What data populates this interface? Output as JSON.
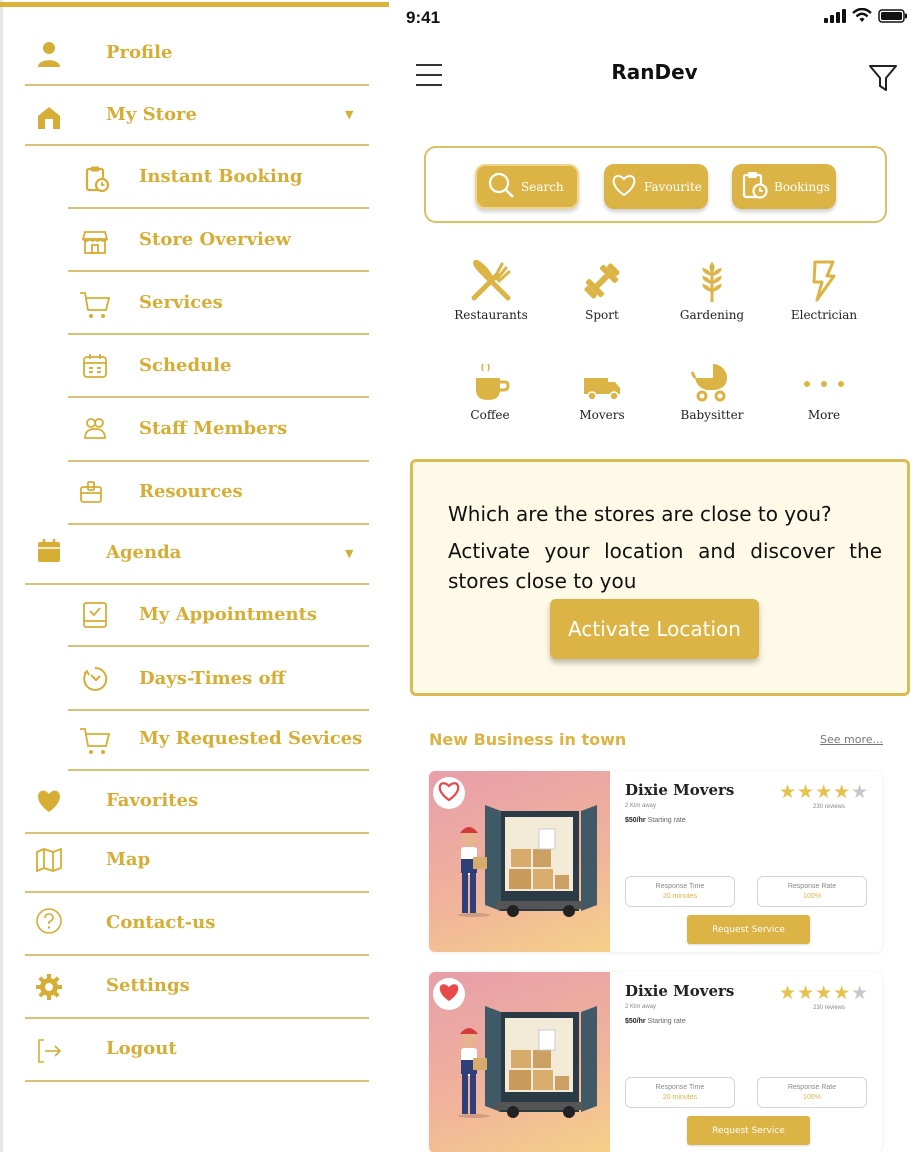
{
  "colors": {
    "accent": "#dcb446",
    "divider": "#dcc07a",
    "card_bg": "#fff9e7",
    "heart_red": "#e84a4a"
  },
  "drawer": {
    "items": [
      {
        "label": "Profile",
        "icon": "person-icon"
      },
      {
        "label": "My Store",
        "icon": "store-icon",
        "caret": "▼"
      },
      {
        "label": "Instant Booking",
        "icon": "clipboard-clock-icon"
      },
      {
        "label": "Store Overview",
        "icon": "storefront-icon"
      },
      {
        "label": "Services",
        "icon": "cart-icon"
      },
      {
        "label": "Schedule",
        "icon": "calendar-icon"
      },
      {
        "label": "Staff Members",
        "icon": "people-icon"
      },
      {
        "label": "Resources",
        "icon": "box-icon"
      },
      {
        "label": "Agenda",
        "icon": "calendar-filled-icon",
        "caret": "▼"
      },
      {
        "label": "My Appointments",
        "icon": "check-square-icon"
      },
      {
        "label": "Days-Times off",
        "icon": "timer-icon"
      },
      {
        "label": "My Requested Sevices",
        "icon": "cart-icon"
      },
      {
        "label": "Favorites",
        "icon": "heart-icon"
      },
      {
        "label": "Map",
        "icon": "map-icon"
      },
      {
        "label": "Contact-us",
        "icon": "question-icon"
      },
      {
        "label": "Settings",
        "icon": "gear-icon"
      },
      {
        "label": "Logout",
        "icon": "logout-icon"
      }
    ]
  },
  "status_bar": {
    "time": "9:41"
  },
  "header": {
    "title": "RanDev"
  },
  "actions": {
    "search": "Search",
    "favourite": "Favourite",
    "bookings": "Bookings"
  },
  "categories": [
    {
      "label": "Restaurants",
      "icon": "fork-knife-icon"
    },
    {
      "label": "Sport",
      "icon": "dumbbell-icon"
    },
    {
      "label": "Gardening",
      "icon": "wheat-icon"
    },
    {
      "label": "Electrician",
      "icon": "bolt-icon"
    },
    {
      "label": "Coffee",
      "icon": "coffee-icon"
    },
    {
      "label": "Movers",
      "icon": "truck-icon"
    },
    {
      "label": "Babysitter",
      "icon": "stroller-icon"
    },
    {
      "label": "More",
      "icon": "more-dots-icon"
    }
  ],
  "location_card": {
    "question": "Which are the stores are close to you?",
    "text": "Activate your location and discover the stores close to you",
    "button": "Activate Location"
  },
  "new_business": {
    "title": "New Business in town",
    "see_more": "See more..."
  },
  "businesses": [
    {
      "name": "Dixie Movers",
      "distance": "2 Klm away",
      "rate": "$50/hr",
      "rate_label": "Starting rate",
      "reviews": "230 reviews",
      "response_time_label": "Response Time",
      "response_time": "20 minutes",
      "response_rate_label": "Response Rate",
      "response_rate": "100%",
      "button": "Request Service",
      "rating": 4.5,
      "favorited": false
    },
    {
      "name": "Dixie Movers",
      "distance": "2 Klm away",
      "rate": "$50/hr",
      "rate_label": "Starting rate",
      "reviews": "230 reviews",
      "response_time_label": "Response Time",
      "response_time": "20 minutes",
      "response_rate_label": "Response Rate",
      "response_rate": "100%",
      "button": "Request Service",
      "rating": 4.5,
      "favorited": true
    }
  ]
}
